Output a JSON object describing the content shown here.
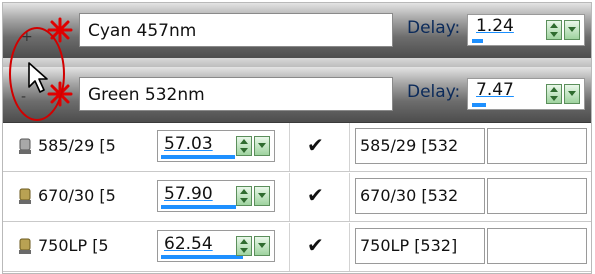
{
  "lasers": [
    {
      "expand": "+",
      "name": "Cyan 457nm",
      "delay_label": "Delay:",
      "delay_value": "1.24",
      "delay_level": 0.15
    },
    {
      "expand": "-",
      "name": "Green 532nm",
      "delay_label": "Delay:",
      "delay_value": "7.47",
      "delay_level": 0.18
    }
  ],
  "filters": [
    {
      "name": "585/29 [5",
      "percent": "57.03",
      "level": 0.57,
      "checked": "✔",
      "alias": "585/29 [532"
    },
    {
      "name": "670/30 [5",
      "percent": "57.90",
      "level": 0.58,
      "checked": "✔",
      "alias": "670/30 [532"
    },
    {
      "name": "750LP [5",
      "percent": "62.54",
      "level": 0.63,
      "checked": "✔",
      "alias": "750LP [532]"
    }
  ],
  "icons": {
    "star": "red-star-icon",
    "spinner": "spinner-icon",
    "filter": "filter-icon",
    "cursor": "mouse-cursor-icon"
  },
  "colors": {
    "highlight": "#d10000",
    "bar": "#1e90ff",
    "delay_label": "#0b2a5a"
  }
}
